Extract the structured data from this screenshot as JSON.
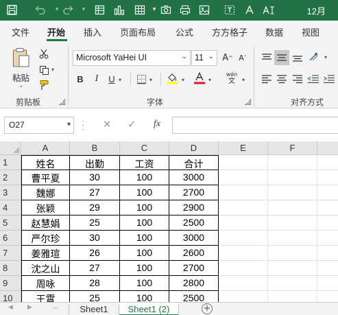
{
  "title_bar": {
    "title": "12月",
    "quick_access": [
      "save-icon",
      "undo-icon",
      "redo-icon",
      "form-icon",
      "chart-icon",
      "table-icon",
      "camera-icon",
      "picture-icon",
      "textbox-icon",
      "text-format-icon",
      "font-size-icon"
    ]
  },
  "tabs": [
    "文件",
    "开始",
    "插入",
    "页面布局",
    "公式",
    "方方格子",
    "数据",
    "视图"
  ],
  "active_tab": "开始",
  "ribbon": {
    "clipboard": {
      "paste_label": "粘贴",
      "group_label": "剪贴板"
    },
    "font": {
      "font_name": "Microsoft YaHei UI",
      "font_size": "11",
      "group_label": "字体",
      "bold": "B",
      "italic": "I",
      "underline": "U",
      "phonetic_top": "wén",
      "phonetic_bottom": "文"
    },
    "alignment": {
      "group_label": "对齐方式"
    }
  },
  "formula_bar": {
    "name_box": "O27",
    "fx_label": "fx",
    "cancel_symbol": "✕",
    "enter_symbol": "✓",
    "formula": ""
  },
  "grid": {
    "columns": [
      "A",
      "B",
      "C",
      "D",
      "E",
      "F"
    ],
    "row_numbers": [
      "1",
      "2",
      "3",
      "4",
      "5",
      "6",
      "7",
      "8",
      "9",
      "10"
    ],
    "rows": [
      [
        "姓名",
        "出勤",
        "工资",
        "合计"
      ],
      [
        "曹平夏",
        "30",
        "100",
        "3000"
      ],
      [
        "魏娜",
        "27",
        "100",
        "2700"
      ],
      [
        "张颖",
        "29",
        "100",
        "2900"
      ],
      [
        "赵慧娟",
        "25",
        "100",
        "2500"
      ],
      [
        "严尔珍",
        "30",
        "100",
        "3000"
      ],
      [
        "姜雅瑄",
        "26",
        "100",
        "2600"
      ],
      [
        "沈之山",
        "27",
        "100",
        "2700"
      ],
      [
        "周咏",
        "28",
        "100",
        "2800"
      ],
      [
        "王霄",
        "25",
        "100",
        "2500"
      ]
    ]
  },
  "sheets": [
    "Sheet1",
    "Sheet1 (2)"
  ],
  "active_sheet": "Sheet1 (2)",
  "colors": {
    "accent": "#217346",
    "font_highlight": "#ffff00",
    "font_color": "#e81123"
  }
}
